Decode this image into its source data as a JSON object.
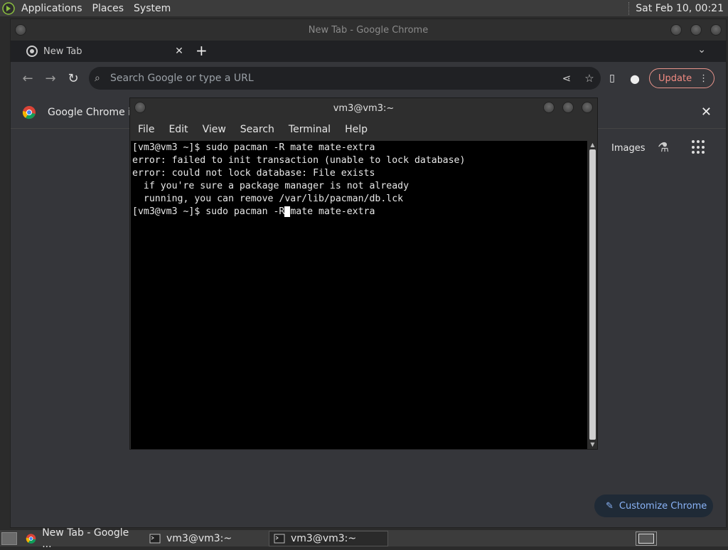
{
  "top_panel": {
    "menus": [
      "Applications",
      "Places",
      "System"
    ],
    "clock": "Sat Feb 10, 00:21"
  },
  "chrome": {
    "window_title": "New Tab - Google Chrome",
    "tab_title": "New Tab",
    "omnibox_placeholder": "Search Google or type a URL",
    "update_label": "Update",
    "infobar_text": "Google Chrome isn",
    "ntp_images_link": "Images",
    "customize_label": "Customize Chrome"
  },
  "terminal": {
    "title": "vm3@vm3:~",
    "menu": [
      "File",
      "Edit",
      "View",
      "Search",
      "Terminal",
      "Help"
    ],
    "lines": [
      "[vm3@vm3 ~]$ sudo pacman -R mate mate-extra",
      "error: failed to init transaction (unable to lock database)",
      "error: could not lock database: File exists",
      "  if you're sure a package manager is not already",
      "  running, you can remove /var/lib/pacman/db.lck"
    ],
    "prompt_before_cursor": "[vm3@vm3 ~]$ sudo pacman -R",
    "cursor_char": " ",
    "prompt_after_cursor": "mate mate-extra"
  },
  "taskbar": {
    "tasks": [
      {
        "label": "New Tab - Google ...",
        "icon": "chrome-icon",
        "active": false
      },
      {
        "label": "vm3@vm3:~",
        "icon": "terminal-icon",
        "active": false
      },
      {
        "label": "vm3@vm3:~",
        "icon": "terminal-icon",
        "active": true
      }
    ]
  },
  "colors": {
    "accent_link": "#8ab4f8",
    "update_red": "#f28b82",
    "terminal_bg": "#000000"
  }
}
